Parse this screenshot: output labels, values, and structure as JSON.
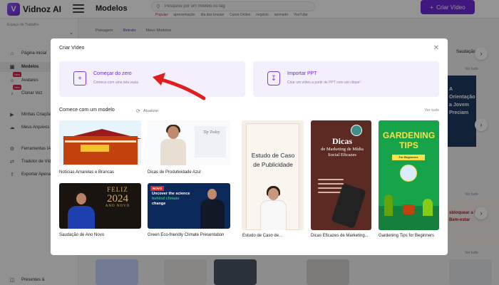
{
  "app": {
    "logo_text": "Vidnoz AI",
    "title": "Modelos",
    "search_placeholder": "Pesquise por um modelo ou tag",
    "tags": [
      "Popular",
      "apresentação",
      "dia das bruxas",
      "Curso Online",
      "negócio",
      "animado",
      "YouTube"
    ],
    "create_button": "Criar Vídeo"
  },
  "sidebar": {
    "workspace_label": "Espaço de Trabalho",
    "items": [
      {
        "label": "Página inicial",
        "icon": "home-icon"
      },
      {
        "label": "Modelos",
        "icon": "template-icon"
      },
      {
        "label": "Avatares",
        "icon": "avatar-icon",
        "badge": "New"
      },
      {
        "label": "Clonar Voz",
        "icon": "voice-icon",
        "badge": "New"
      },
      {
        "label": "Minhas Criações",
        "icon": "video-icon"
      },
      {
        "label": "Meus Arquivos",
        "icon": "cloud-icon"
      },
      {
        "label": "Ferramentas IA",
        "icon": "tools-icon"
      },
      {
        "label": "Tradutor de Vídeo",
        "icon": "translate-icon"
      },
      {
        "label": "Exportar Apenas",
        "icon": "export-icon"
      },
      {
        "label": "Presentes &",
        "icon": "gift-icon"
      }
    ]
  },
  "bg_tabs": [
    "Paisagem",
    "Retrato",
    "Meus Modelos"
  ],
  "bg_right": {
    "label": "Saudação",
    "ver_tudo_1": "Ver tudo",
    "ver_tudo_2": "Ver tudo",
    "ver_tudo_3": "Ver tudo"
  },
  "bg_right_texts": {
    "a": "A Orientação",
    "b": "a Jovem",
    "c": "Preciam",
    "d": "sbloquear a Paz",
    "e": "Bem-estar"
  },
  "modal": {
    "title": "Criar Vídeo",
    "close_icon": "close-icon",
    "option_1": {
      "title": "Começar do zero",
      "subtitle": "Comece com uma tela vazia"
    },
    "option_2": {
      "title": "Importar PPT",
      "subtitle": "Criar um vídeo a partir de PPT com um clique!"
    },
    "section_title": "Comece com um modelo",
    "refresh_label": "Atualizar",
    "see_all": "Ver tudo",
    "templates": [
      {
        "label": "Notícias Amarelas e Brancas"
      },
      {
        "label": "Dicas de Produtividade Azul"
      },
      {
        "label": "Estudo de Caso de..."
      },
      {
        "label": "Dicas Eficazes de Marketing..."
      },
      {
        "label": "Gardening Tips for Beginners"
      },
      {
        "label": "Saudação de Ano Novo"
      },
      {
        "label": "Green Eco-friendly Climate Presentation"
      }
    ],
    "thumb_texts": {
      "tip_today": "Tip Today",
      "estudo": "Estudo de Caso de Publicidade",
      "dicas_big": "Dicas",
      "dicas_small": "de Marketing de Mídia Social Eficazes",
      "gardening": "GARDENING TIPS",
      "for_beginners": "For Beginners",
      "feliz": "FELIZ",
      "year": "2024",
      "ano_novo": "ANO NOVO",
      "novo": "NOVO",
      "uncover_1": "Uncover the science",
      "uncover_2": "behind climate",
      "uncover_3": "change"
    }
  },
  "colors": {
    "accent": "#6d28d9",
    "option_bg": "#f3effd",
    "overlay": "rgba(0,0,0,0.42)"
  }
}
